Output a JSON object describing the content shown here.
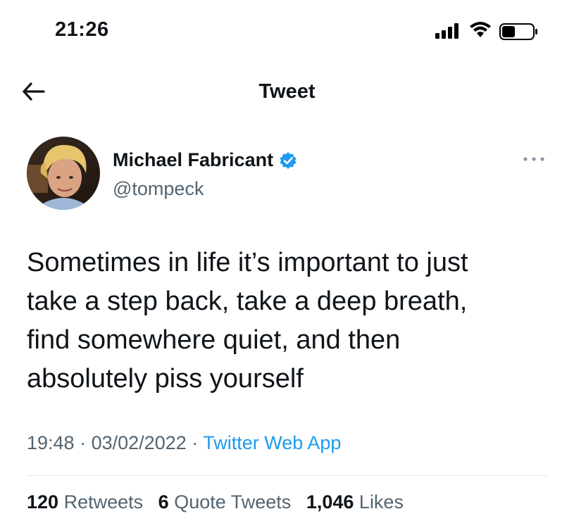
{
  "status_bar": {
    "time": "21:26",
    "icons": [
      "cellular-signal-icon",
      "wifi-icon",
      "battery-icon"
    ]
  },
  "nav": {
    "back_icon": "arrow-left-icon",
    "title": "Tweet"
  },
  "author": {
    "display_name": "Michael Fabricant",
    "verified": true,
    "handle": "@tompeck",
    "more_icon": "ellipsis-icon"
  },
  "tweet": {
    "lines": [
      "Sometimes in life it’s important to just",
      "take a step back, take a deep breath,",
      "find somewhere quiet, and then",
      "absolutely piss yourself"
    ]
  },
  "meta": {
    "time": "19:48",
    "separator": "·",
    "date": "03/02/2022",
    "source": "Twitter Web App"
  },
  "stats": {
    "retweets_count": "120",
    "retweets_label": "Retweets",
    "quotes_count": "6",
    "quotes_label": "Quote Tweets",
    "likes_count": "1,046",
    "likes_label": "Likes"
  },
  "colors": {
    "accent": "#1d9bf0",
    "text": "#0f1419",
    "secondary": "#536471",
    "divider": "#e5e8eb"
  }
}
